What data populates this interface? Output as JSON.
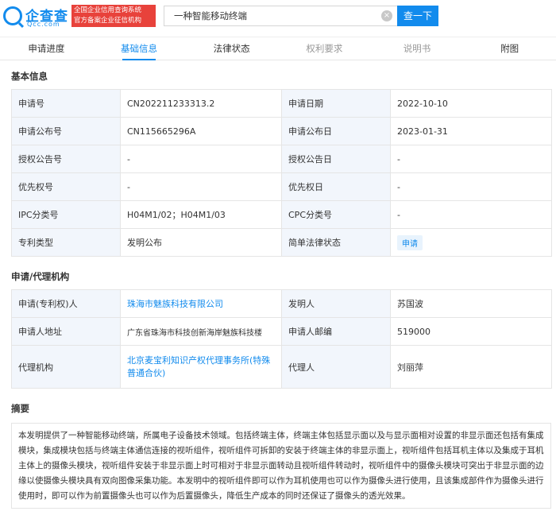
{
  "header": {
    "logo_name": "企查查",
    "logo_domain": "Qcc.com",
    "slogan_line1": "全国企业信用查询系统",
    "slogan_line2": "官方备案企业征信机构",
    "search_value": "一种智能移动终端",
    "search_button": "查一下"
  },
  "tabs": [
    {
      "label": "申请进度"
    },
    {
      "label": "基础信息"
    },
    {
      "label": "法律状态"
    },
    {
      "label": "权利要求"
    },
    {
      "label": "说明书"
    },
    {
      "label": "附图"
    }
  ],
  "basic": {
    "title": "基本信息",
    "rows": [
      {
        "l1": "申请号",
        "v1": "CN202211233313.2",
        "l2": "申请日期",
        "v2": "2022-10-10"
      },
      {
        "l1": "申请公布号",
        "v1": "CN115665296A",
        "l2": "申请公布日",
        "v2": "2023-01-31"
      },
      {
        "l1": "授权公告号",
        "v1": "-",
        "l2": "授权公告日",
        "v2": "-"
      },
      {
        "l1": "优先权号",
        "v1": "-",
        "l2": "优先权日",
        "v2": "-"
      },
      {
        "l1": "IPC分类号",
        "v1": "H04M1/02；H04M1/03",
        "l2": "CPC分类号",
        "v2": "-"
      },
      {
        "l1": "专利类型",
        "v1": "发明公布",
        "l2": "简单法律状态",
        "v2": "申请"
      }
    ]
  },
  "agency": {
    "title": "申请/代理机构",
    "rows": [
      {
        "l1": "申请(专利权)人",
        "v1": "珠海市魅族科技有限公司",
        "l2": "发明人",
        "v2": "苏国波"
      },
      {
        "l1": "申请人地址",
        "v1": "广东省珠海市科技创新海岸魅族科技楼",
        "l2": "申请人邮编",
        "v2": "519000"
      },
      {
        "l1": "代理机构",
        "v1": "北京麦宝利知识产权代理事务所(特殊普通合伙)",
        "l2": "代理人",
        "v2": "刘丽萍"
      }
    ]
  },
  "abstract": {
    "title": "摘要",
    "text": "本发明提供了一种智能移动终端，所属电子设备技术领域。包括终端主体，终端主体包括显示面以及与显示面相对设置的非显示面还包括有集成模块，集成模块包括与终端主体通信连接的视听组件，视听组件可拆卸的安装于终端主体的非显示面上，视听组件包括耳机主体以及集成于耳机主体上的摄像头模块，视听组件安装于非显示面上时可相对于非显示面转动且视听组件转动时，视听组件中的摄像头模块可突出于非显示面的边缘以使摄像头模块具有双向图像采集功能。本发明中的视听组件即可以作为耳机使用也可以作为摄像头进行使用，且该集成部件作为摄像头进行使用时，即可以作为前置摄像头也可以作为后置摄像头，降低生产成本的同时还保证了摄像头的透光效果。"
  }
}
